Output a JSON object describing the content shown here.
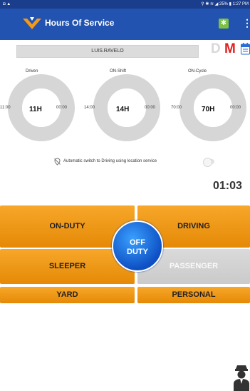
{
  "status_bar": {
    "left_icons": "◘ ▲",
    "right": "⚲ ✱ ≋ ◢ 25% ▮ 1:27 PM"
  },
  "app_bar": {
    "title": "Hours Of Service",
    "bluetooth_icon": "bluetooth-icon",
    "menu_icon": "⋮"
  },
  "driver": {
    "name": "LUIS.RAVELO"
  },
  "badges": {
    "d": "D",
    "m": "M",
    "d_color": "#d8d8d8",
    "m_color": "#e02020"
  },
  "gauges": [
    {
      "label": "Driven",
      "start": "11:00",
      "value": "11H",
      "end": "00:00",
      "remaining_fraction": 1.0
    },
    {
      "label": "ON-Shift",
      "start": "14:00",
      "value": "14H",
      "end": "00:00",
      "remaining_fraction": 1.0
    },
    {
      "label": "ON-Cycle",
      "start": "70:00",
      "value": "70H",
      "end": "00:00",
      "remaining_fraction": 1.0
    }
  ],
  "auto_switch": {
    "label": "Automatic switch to Driving using location service",
    "enabled": false
  },
  "timer": "01:03",
  "buttons": {
    "on_duty": "ON-DUTY",
    "driving": "DRIVING",
    "sleeper": "SLEEPER",
    "passenger": "PASSENGER",
    "yard": "YARD",
    "personal": "PERSONAL",
    "off_duty_line1": "OFF",
    "off_duty_line2": "DUTY"
  },
  "colors": {
    "app_bar": "#2253b0",
    "status_bar": "#1a3d8c",
    "button": "#f39a18",
    "off_duty": "#1a6fe0",
    "gauge_ring": "#d6d6d6"
  }
}
